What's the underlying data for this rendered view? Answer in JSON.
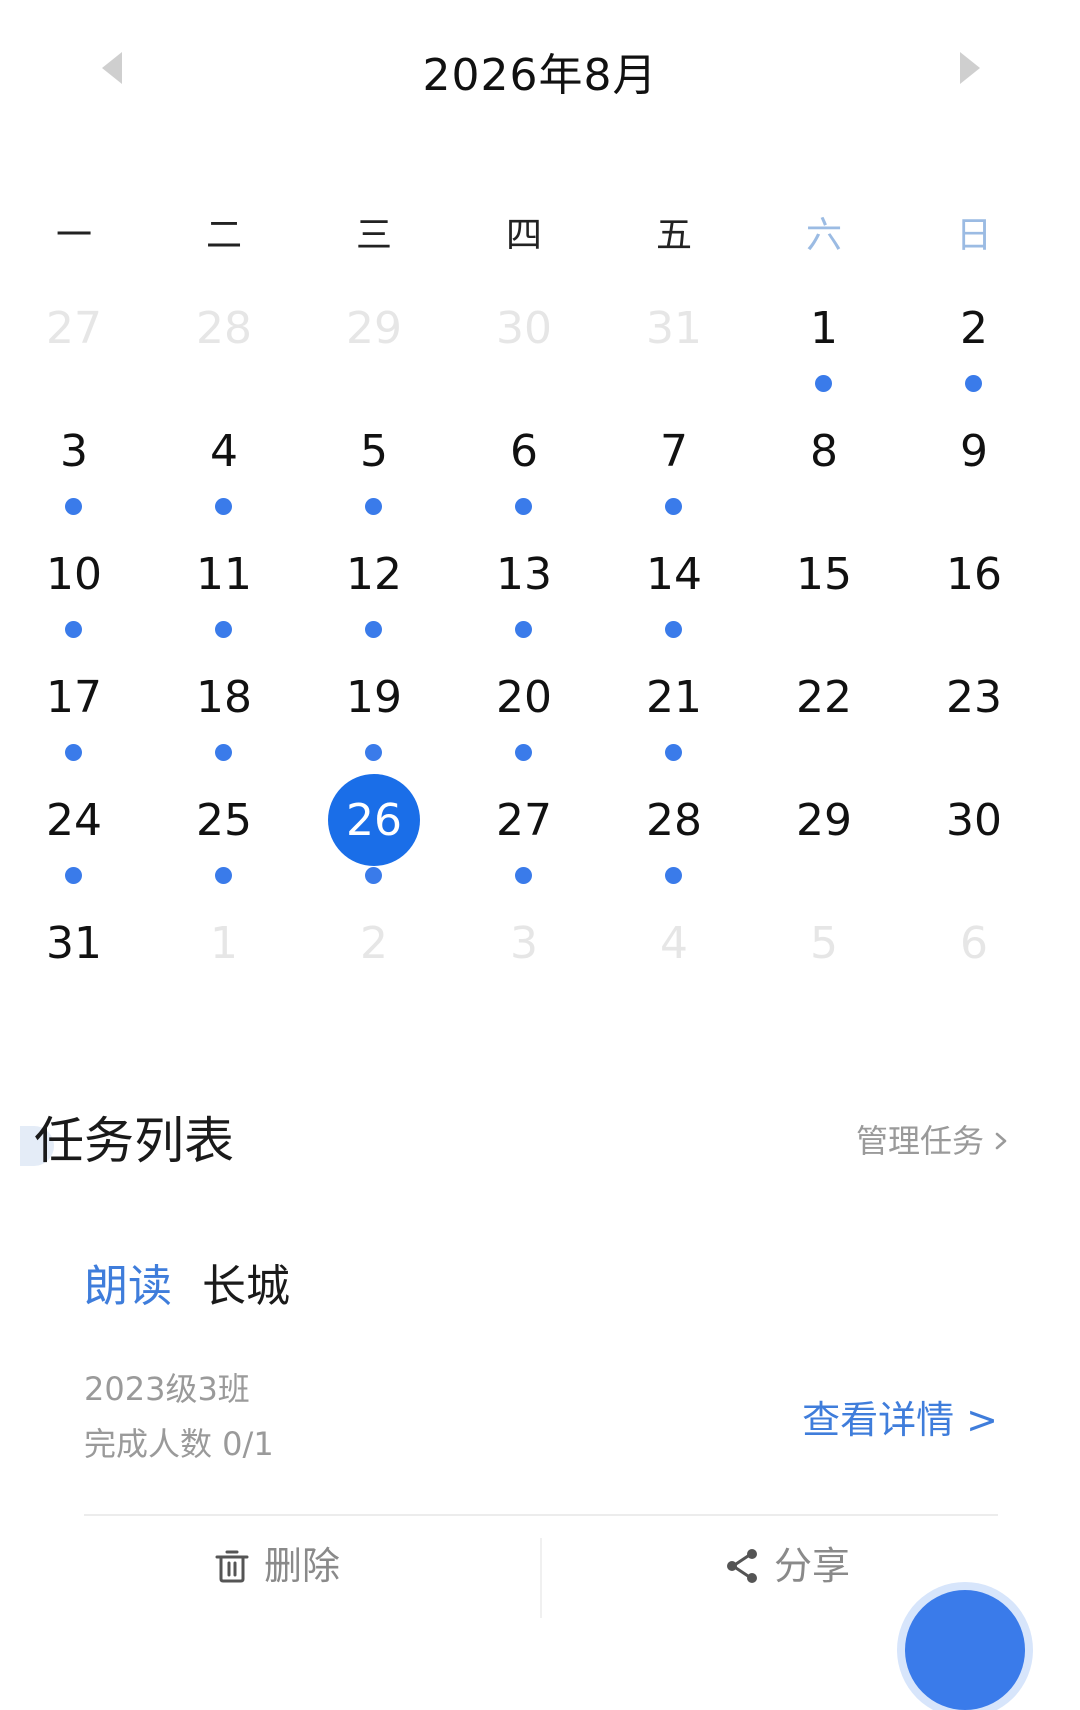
{
  "header": {
    "title": "2026年8月"
  },
  "weekdays": [
    "一",
    "二",
    "三",
    "四",
    "五",
    "六",
    "日"
  ],
  "calendar": {
    "days": [
      {
        "label": "27",
        "other": true,
        "dot": false
      },
      {
        "label": "28",
        "other": true,
        "dot": false
      },
      {
        "label": "29",
        "other": true,
        "dot": false
      },
      {
        "label": "30",
        "other": true,
        "dot": false
      },
      {
        "label": "31",
        "other": true,
        "dot": false
      },
      {
        "label": "1",
        "other": false,
        "dot": true
      },
      {
        "label": "2",
        "other": false,
        "dot": true
      },
      {
        "label": "3",
        "other": false,
        "dot": true
      },
      {
        "label": "4",
        "other": false,
        "dot": true
      },
      {
        "label": "5",
        "other": false,
        "dot": true
      },
      {
        "label": "6",
        "other": false,
        "dot": true
      },
      {
        "label": "7",
        "other": false,
        "dot": true
      },
      {
        "label": "8",
        "other": false,
        "dot": false
      },
      {
        "label": "9",
        "other": false,
        "dot": false
      },
      {
        "label": "10",
        "other": false,
        "dot": true
      },
      {
        "label": "11",
        "other": false,
        "dot": true
      },
      {
        "label": "12",
        "other": false,
        "dot": true
      },
      {
        "label": "13",
        "other": false,
        "dot": true
      },
      {
        "label": "14",
        "other": false,
        "dot": true
      },
      {
        "label": "15",
        "other": false,
        "dot": false
      },
      {
        "label": "16",
        "other": false,
        "dot": false
      },
      {
        "label": "17",
        "other": false,
        "dot": true
      },
      {
        "label": "18",
        "other": false,
        "dot": true
      },
      {
        "label": "19",
        "other": false,
        "dot": true
      },
      {
        "label": "20",
        "other": false,
        "dot": true
      },
      {
        "label": "21",
        "other": false,
        "dot": true
      },
      {
        "label": "22",
        "other": false,
        "dot": false
      },
      {
        "label": "23",
        "other": false,
        "dot": false
      },
      {
        "label": "24",
        "other": false,
        "dot": true
      },
      {
        "label": "25",
        "other": false,
        "dot": true
      },
      {
        "label": "26",
        "other": false,
        "dot": true,
        "selected": true
      },
      {
        "label": "27",
        "other": false,
        "dot": true
      },
      {
        "label": "28",
        "other": false,
        "dot": true
      },
      {
        "label": "29",
        "other": false,
        "dot": false
      },
      {
        "label": "30",
        "other": false,
        "dot": false
      },
      {
        "label": "31",
        "other": false,
        "dot": false
      },
      {
        "label": "1",
        "other": true,
        "dot": false
      },
      {
        "label": "2",
        "other": true,
        "dot": false
      },
      {
        "label": "3",
        "other": true,
        "dot": false
      },
      {
        "label": "4",
        "other": true,
        "dot": false
      },
      {
        "label": "5",
        "other": true,
        "dot": false
      },
      {
        "label": "6",
        "other": true,
        "dot": false
      }
    ]
  },
  "task_list": {
    "title": "任务列表",
    "manage_label": "管理任务"
  },
  "task": {
    "type": "朗读",
    "name": "长城",
    "class": "2023级3班",
    "completion": "完成人数 0/1",
    "details_label": "查看详情 >",
    "delete_label": "删除",
    "share_label": "分享"
  },
  "icons": {
    "prev": "triangle-left-icon",
    "next": "triangle-right-icon",
    "manage": "chevron-right-icon",
    "delete": "trash-icon",
    "share": "share-icon"
  },
  "colors": {
    "accent": "#1a6ee8",
    "dot": "#3a7bea",
    "link": "#3f7ddb",
    "weekend": "#9bbbe3",
    "muted": "#9a9a9a"
  }
}
